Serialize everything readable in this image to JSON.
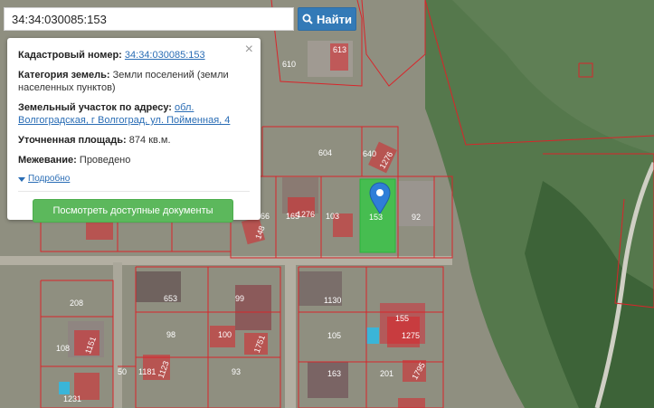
{
  "search": {
    "value": "34:34:030085:153",
    "button_label": "Найти",
    "icon": "search-icon"
  },
  "popup": {
    "close_label": "×",
    "cadastral_label": "Кадастровый номер:",
    "cadastral_value": "34:34:030085:153",
    "category_label": "Категория земель:",
    "category_value": "Земли поселений (земли населенных пунктов)",
    "address_label": "Земельный участок по адресу:",
    "address_value": "обл. Волгоградская, г Волгоград, ул. Пойменная, 4",
    "area_label": "Уточненная площадь:",
    "area_value": "874 кв.м.",
    "survey_label": "Межевание:",
    "survey_value": "Проведено",
    "details_label": "Подробно",
    "documents_button": "Посмотреть доступные документы"
  },
  "map": {
    "plot_labels": [
      "610",
      "613",
      "604",
      "640",
      "1276",
      "165",
      "103",
      "153",
      "92",
      "66",
      "148",
      "1276",
      "208",
      "653",
      "99",
      "1130",
      "108",
      "98",
      "100",
      "1751",
      "105",
      "155",
      "1275",
      "1151",
      "50",
      "1181",
      "1123",
      "93",
      "163",
      "201",
      "1795",
      "1231"
    ],
    "colors": {
      "parcel_border": "#d9252a",
      "selected_fill": "#2ecc40",
      "marker": "#2f7ed8",
      "button_primary": "#337ab7",
      "button_success": "#5cb85c"
    }
  }
}
